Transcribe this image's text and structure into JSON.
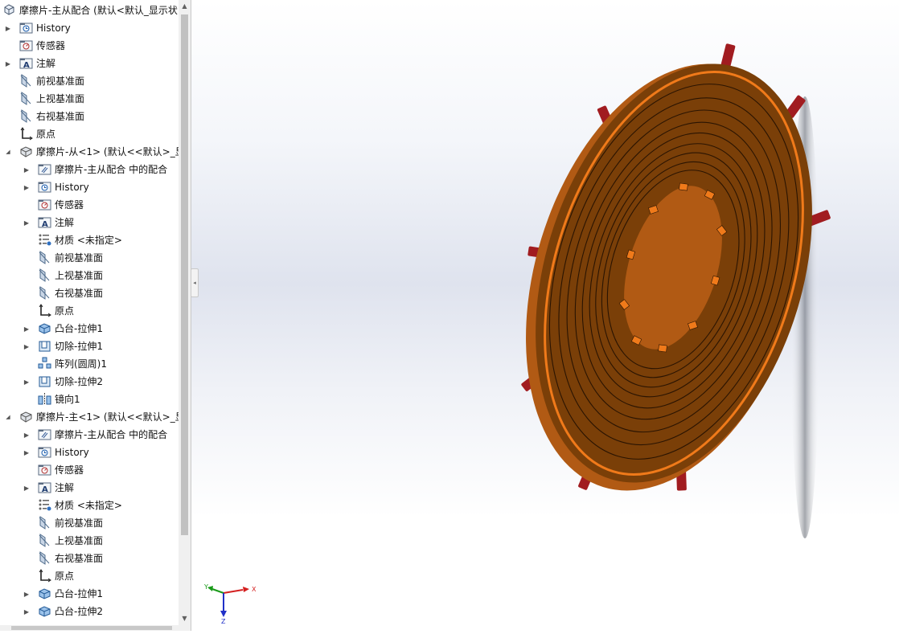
{
  "tree": {
    "items": [
      {
        "label": "摩擦片-主从配合  (默认<默认_显示状",
        "icon": "assembly-icon",
        "expander": "down",
        "level": 0
      },
      {
        "label": "History",
        "icon": "history-icon",
        "expander": "right",
        "level": 1
      },
      {
        "label": "传感器",
        "icon": "sensor-icon",
        "expander": "none",
        "level": 1
      },
      {
        "label": "注解",
        "icon": "annotation-icon",
        "expander": "right",
        "level": 1
      },
      {
        "label": "前视基准面",
        "icon": "plane-icon",
        "expander": "none",
        "level": 1
      },
      {
        "label": "上视基准面",
        "icon": "plane-icon",
        "expander": "none",
        "level": 1
      },
      {
        "label": "右视基准面",
        "icon": "plane-icon",
        "expander": "none",
        "level": 1
      },
      {
        "label": "原点",
        "icon": "origin-icon",
        "expander": "none",
        "level": 1
      },
      {
        "label": "摩擦片-从<1> (默认<<默认>_显",
        "icon": "part-icon",
        "expander": "down",
        "level": 1
      },
      {
        "label": "摩擦片-主从配合 中的配合",
        "icon": "mates-folder-icon",
        "expander": "right",
        "level": 2
      },
      {
        "label": "History",
        "icon": "history-icon",
        "expander": "right",
        "level": 2
      },
      {
        "label": "传感器",
        "icon": "sensor-icon",
        "expander": "none",
        "level": 2
      },
      {
        "label": "注解",
        "icon": "annotation-icon",
        "expander": "right",
        "level": 2
      },
      {
        "label": "材质 <未指定>",
        "icon": "material-icon",
        "expander": "none",
        "level": 2
      },
      {
        "label": "前视基准面",
        "icon": "plane-icon",
        "expander": "none",
        "level": 2
      },
      {
        "label": "上视基准面",
        "icon": "plane-icon",
        "expander": "none",
        "level": 2
      },
      {
        "label": "右视基准面",
        "icon": "plane-icon",
        "expander": "none",
        "level": 2
      },
      {
        "label": "原点",
        "icon": "origin-icon",
        "expander": "none",
        "level": 2
      },
      {
        "label": "凸台-拉伸1",
        "icon": "extrude-boss-icon",
        "expander": "right",
        "level": 2
      },
      {
        "label": "切除-拉伸1",
        "icon": "extrude-cut-icon",
        "expander": "right",
        "level": 2
      },
      {
        "label": "阵列(圆周)1",
        "icon": "circular-pattern-icon",
        "expander": "none",
        "level": 2
      },
      {
        "label": "切除-拉伸2",
        "icon": "extrude-cut-icon",
        "expander": "right",
        "level": 2
      },
      {
        "label": "镜向1",
        "icon": "mirror-icon",
        "expander": "none",
        "level": 2
      },
      {
        "label": "摩擦片-主<1> (默认<<默认>_显",
        "icon": "part-icon",
        "expander": "down",
        "level": 1
      },
      {
        "label": "摩擦片-主从配合 中的配合",
        "icon": "mates-folder-icon",
        "expander": "right",
        "level": 2
      },
      {
        "label": "History",
        "icon": "history-icon",
        "expander": "right",
        "level": 2
      },
      {
        "label": "传感器",
        "icon": "sensor-icon",
        "expander": "none",
        "level": 2
      },
      {
        "label": "注解",
        "icon": "annotation-icon",
        "expander": "right",
        "level": 2
      },
      {
        "label": "材质 <未指定>",
        "icon": "material-icon",
        "expander": "none",
        "level": 2
      },
      {
        "label": "前视基准面",
        "icon": "plane-icon",
        "expander": "none",
        "level": 2
      },
      {
        "label": "上视基准面",
        "icon": "plane-icon",
        "expander": "none",
        "level": 2
      },
      {
        "label": "右视基准面",
        "icon": "plane-icon",
        "expander": "none",
        "level": 2
      },
      {
        "label": "原点",
        "icon": "origin-icon",
        "expander": "none",
        "level": 2
      },
      {
        "label": "凸台-拉伸1",
        "icon": "extrude-boss-icon",
        "expander": "right",
        "level": 2
      },
      {
        "label": "凸台-拉伸2",
        "icon": "extrude-boss-icon",
        "expander": "right",
        "level": 2
      }
    ]
  },
  "triad": {
    "x": "X",
    "y": "Y",
    "z": "Z"
  },
  "colors": {
    "disc_fill": "#7a3f08",
    "disc_groove": "#2a1402",
    "disc_highlight": "#f07a1a",
    "disc_rim": "#b15a14",
    "tabs": "#a11c20",
    "axis_x": "#d42020",
    "axis_y": "#1a9a1a",
    "axis_z": "#2030c8"
  }
}
